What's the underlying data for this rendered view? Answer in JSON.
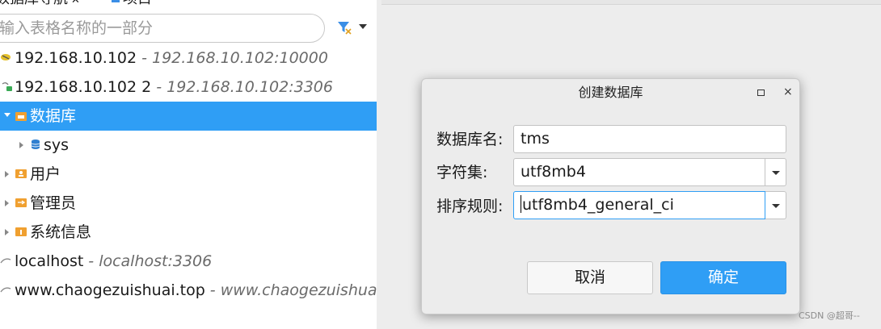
{
  "navigator": {
    "tabs": [
      {
        "label": "数据库导航",
        "close": "✕"
      },
      {
        "label": "项目"
      }
    ],
    "filter_placeholder": "输入表格名称的一部分",
    "tree": [
      {
        "label": "192.168.10.102",
        "sub": "- 192.168.10.102:10000"
      },
      {
        "label": "192.168.10.102 2",
        "sub": "- 192.168.10.102:3306"
      },
      {
        "label": "数据库",
        "selected": true
      },
      {
        "label": "sys"
      },
      {
        "label": "用户"
      },
      {
        "label": "管理员"
      },
      {
        "label": "系统信息"
      },
      {
        "label": "localhost",
        "sub": "- localhost:3306"
      },
      {
        "label": "www.chaogezuishuai.top",
        "sub": "- www.chaogezuishuai.top"
      }
    ]
  },
  "dialog": {
    "title": "创建数据库",
    "max": "▫",
    "close": "×",
    "db_name_label": "数据库名:",
    "db_name_value": "tms",
    "charset_label": "字符集:",
    "charset_value": "utf8mb4",
    "collation_label": "排序规则:",
    "collation_value": "utf8mb4_general_ci",
    "cancel": "取消",
    "ok": "确定"
  },
  "watermark": "CSDN @超哥--",
  "colors": {
    "accent": "#2f9ef5",
    "folder": "#f0a030"
  }
}
